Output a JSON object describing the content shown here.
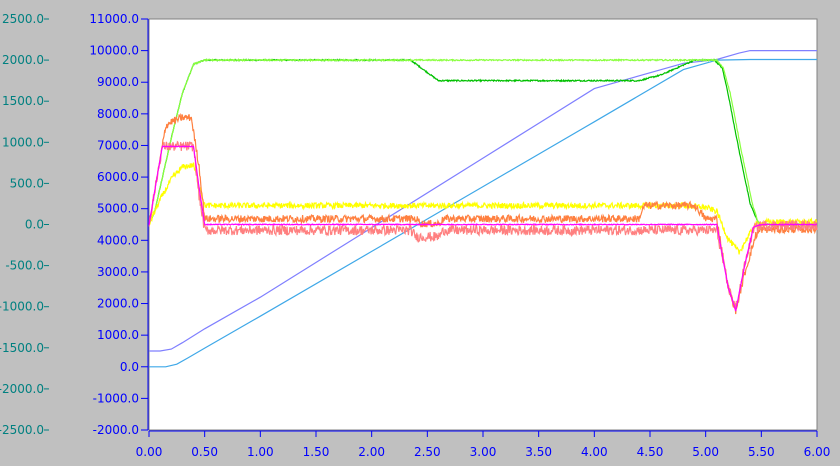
{
  "chart_data": {
    "type": "line",
    "title": "",
    "xlabel": "",
    "xlim": [
      0,
      6
    ],
    "x_ticks": [
      "0.00",
      "0.50",
      "1.00",
      "1.50",
      "2.00",
      "2.50",
      "3.00",
      "3.50",
      "4.00",
      "4.50",
      "5.00",
      "5.50",
      "6.00"
    ],
    "left_axis": {
      "color": "#008080",
      "ylim": [
        -2500,
        2500
      ],
      "ticks": [
        "2500.0",
        "2000.0",
        "1500.0",
        "1000.0",
        "500.0",
        "0.0",
        "-500.0",
        "-1000.0",
        "-1500.0",
        "-2000.0",
        "-2500.0"
      ]
    },
    "right_axis": {
      "color": "#0000ff",
      "ylim": [
        -2000,
        11000
      ],
      "ticks": [
        "11000.0",
        "10000.0",
        "9000.0",
        "8000.0",
        "7000.0",
        "6000.0",
        "5000.0",
        "4000.0",
        "3000.0",
        "2000.0",
        "1000.0",
        "0.0",
        "-1000.0",
        "-2000.0"
      ]
    },
    "grid": false,
    "legend": "none",
    "colors": {
      "background": "#c0c0c0",
      "plot_area": "#ffffff"
    },
    "series": [
      {
        "color": "#7f7fff",
        "axis": "right",
        "noise": 0,
        "points": [
          [
            0,
            500
          ],
          [
            0.1,
            500
          ],
          [
            0.2,
            560
          ],
          [
            0.3,
            760
          ],
          [
            0.5,
            1200
          ],
          [
            1,
            2200
          ],
          [
            2,
            4400
          ],
          [
            3,
            6600
          ],
          [
            4,
            8800
          ],
          [
            4.8,
            9600
          ],
          [
            5.1,
            9720
          ],
          [
            5.3,
            9920
          ],
          [
            5.4,
            10000
          ],
          [
            6,
            10000
          ]
        ]
      },
      {
        "color": "#3fa8e8",
        "axis": "right",
        "noise": 0,
        "points": [
          [
            0,
            0
          ],
          [
            0.15,
            0
          ],
          [
            0.25,
            80
          ],
          [
            0.35,
            280
          ],
          [
            0.5,
            590
          ],
          [
            1,
            1600
          ],
          [
            2,
            3650
          ],
          [
            3,
            5700
          ],
          [
            4,
            7750
          ],
          [
            4.8,
            9400
          ],
          [
            5.1,
            9700
          ],
          [
            5.4,
            9720
          ],
          [
            6,
            9720
          ]
        ]
      },
      {
        "color": "#00c000",
        "axis": "left",
        "noise": 8,
        "points": [
          [
            0,
            0
          ],
          [
            0.05,
            150
          ],
          [
            0.1,
            450
          ],
          [
            0.2,
            1050
          ],
          [
            0.3,
            1600
          ],
          [
            0.4,
            1950
          ],
          [
            0.5,
            2000
          ],
          [
            2.35,
            2000
          ],
          [
            2.6,
            1750
          ],
          [
            4.4,
            1750
          ],
          [
            4.6,
            1820
          ],
          [
            4.9,
            2000
          ],
          [
            5.08,
            2000
          ],
          [
            5.15,
            1900
          ],
          [
            5.2,
            1600
          ],
          [
            5.3,
            900
          ],
          [
            5.4,
            250
          ],
          [
            5.47,
            30
          ],
          [
            5.5,
            0
          ],
          [
            6,
            0
          ]
        ]
      },
      {
        "color": "#8aff3f",
        "axis": "left",
        "noise": 8,
        "points": [
          [
            0,
            0
          ],
          [
            0.05,
            150
          ],
          [
            0.1,
            450
          ],
          [
            0.2,
            1050
          ],
          [
            0.3,
            1600
          ],
          [
            0.4,
            1950
          ],
          [
            0.5,
            2000
          ],
          [
            5.1,
            2000
          ],
          [
            5.16,
            1900
          ],
          [
            5.22,
            1600
          ],
          [
            5.32,
            900
          ],
          [
            5.42,
            250
          ],
          [
            5.47,
            30
          ],
          [
            5.5,
            0
          ],
          [
            6,
            0
          ]
        ]
      },
      {
        "color": "#ffff00",
        "axis": "left",
        "noise": 35,
        "points": [
          [
            0,
            0
          ],
          [
            0.1,
            300
          ],
          [
            0.2,
            550
          ],
          [
            0.3,
            700
          ],
          [
            0.4,
            720
          ],
          [
            0.5,
            230
          ],
          [
            0.6,
            230
          ],
          [
            4.8,
            230
          ],
          [
            5.0,
            210
          ],
          [
            5.1,
            160
          ],
          [
            5.2,
            -170
          ],
          [
            5.3,
            -340
          ],
          [
            5.38,
            -150
          ],
          [
            5.45,
            0
          ],
          [
            5.55,
            30
          ],
          [
            6,
            30
          ]
        ]
      },
      {
        "color": "#ff8040",
        "axis": "left",
        "noise": 45,
        "points": [
          [
            0,
            0
          ],
          [
            0.05,
            380
          ],
          [
            0.15,
            1200
          ],
          [
            0.2,
            1250
          ],
          [
            0.3,
            1300
          ],
          [
            0.38,
            1300
          ],
          [
            0.45,
            700
          ],
          [
            0.5,
            70
          ],
          [
            2.4,
            70
          ],
          [
            2.45,
            10
          ],
          [
            2.6,
            10
          ],
          [
            2.65,
            70
          ],
          [
            4.4,
            70
          ],
          [
            4.45,
            230
          ],
          [
            4.9,
            230
          ],
          [
            5.0,
            70
          ],
          [
            5.1,
            70
          ],
          [
            5.2,
            -750
          ],
          [
            5.27,
            -1050
          ],
          [
            5.35,
            -600
          ],
          [
            5.45,
            -130
          ],
          [
            5.5,
            -60
          ],
          [
            6,
            -60
          ]
        ]
      },
      {
        "color": "#ff8080",
        "axis": "left",
        "noise": 60,
        "points": [
          [
            0,
            0
          ],
          [
            0.05,
            400
          ],
          [
            0.12,
            950
          ],
          [
            0.4,
            950
          ],
          [
            0.45,
            350
          ],
          [
            0.5,
            -70
          ],
          [
            2.35,
            -70
          ],
          [
            2.4,
            -150
          ],
          [
            2.6,
            -150
          ],
          [
            2.65,
            -70
          ],
          [
            5.1,
            -70
          ],
          [
            5.2,
            -750
          ],
          [
            5.27,
            -1020
          ],
          [
            5.35,
            -500
          ],
          [
            5.43,
            -50
          ],
          [
            5.5,
            -10
          ],
          [
            6,
            -10
          ]
        ]
      },
      {
        "color": "#ff00ff",
        "axis": "left",
        "noise": 5,
        "points": [
          [
            0,
            0
          ],
          [
            0.05,
            400
          ],
          [
            0.12,
            950
          ],
          [
            0.4,
            950
          ],
          [
            0.45,
            450
          ],
          [
            0.5,
            0
          ],
          [
            5.1,
            0
          ],
          [
            5.2,
            -750
          ],
          [
            5.27,
            -1050
          ],
          [
            5.35,
            -500
          ],
          [
            5.43,
            -30
          ],
          [
            5.5,
            0
          ],
          [
            6,
            0
          ]
        ]
      }
    ]
  }
}
